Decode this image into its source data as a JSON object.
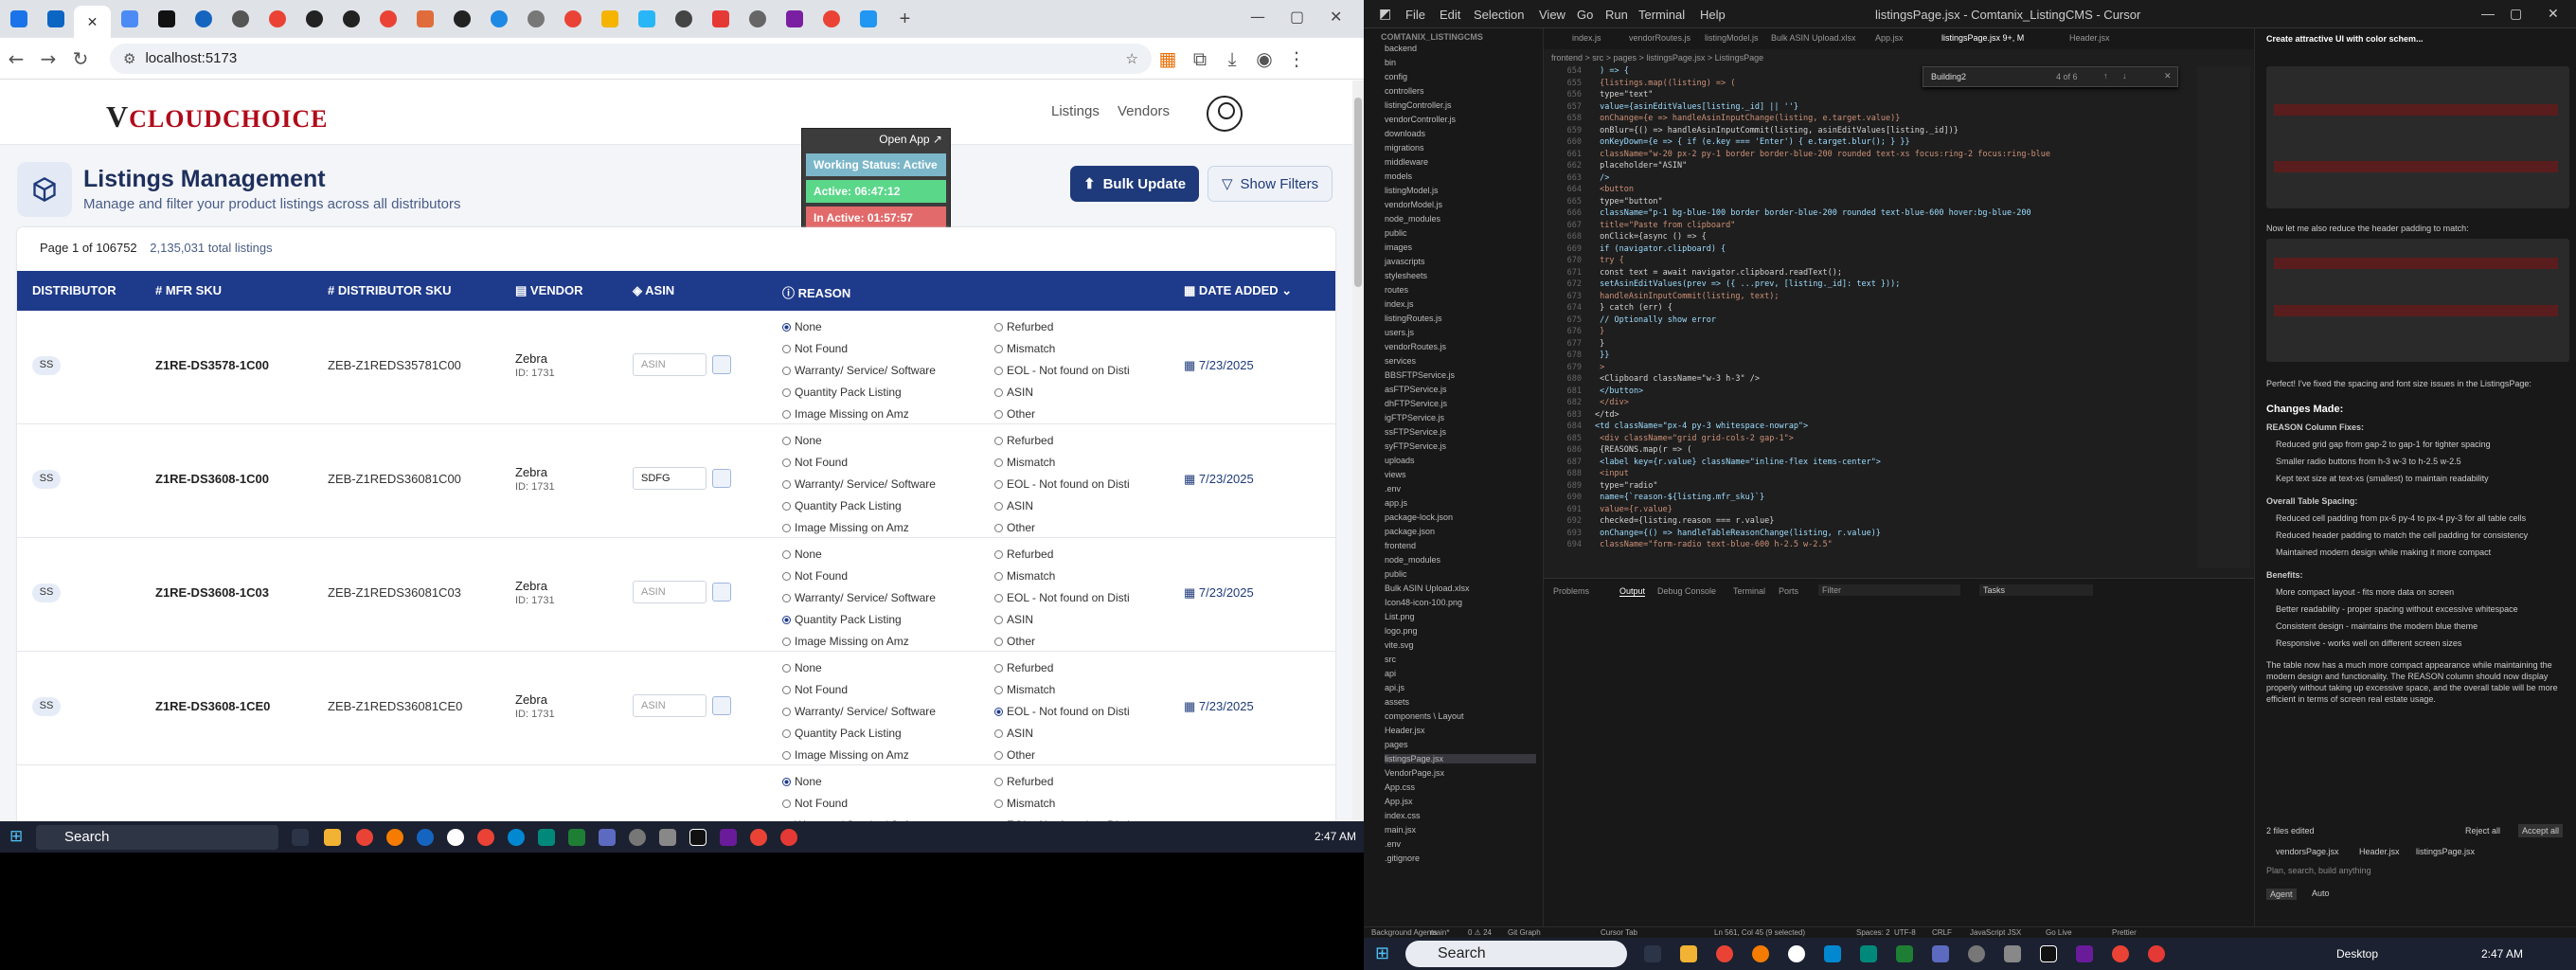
{
  "browser": {
    "url": "localhost:5173"
  },
  "app": {
    "logo_text": "CLOUDCHOICE",
    "logo_v": "V",
    "nav": [
      "Listings",
      "Vendors"
    ],
    "status_popup": {
      "open_label": "Open App ↗",
      "working": "Working Status: Active",
      "active": "Active: 06:47:12",
      "inactive": "In Active: 01:57:57"
    },
    "title": "Listings Management",
    "subtitle": "Manage and filter your product listings across all distributors",
    "bulk_label": "Bulk Update",
    "filters_label": "Show Filters",
    "page_info": "Page 1 of 106752",
    "total": "2,135,031 total listings",
    "columns": [
      "DISTRIBUTOR",
      "MFR SKU",
      "DISTRIBUTOR SKU",
      "VENDOR",
      "ASIN",
      "REASON",
      "DATE ADDED"
    ],
    "asin_placeholder": "ASIN",
    "reasons_left": [
      "None",
      "Not Found",
      "Warranty/ Service/ Software",
      "Quantity Pack Listing",
      "Image Missing on Amz"
    ],
    "reasons_right": [
      "Refurbed",
      "Mismatch",
      "EOL - Not found on Disti",
      "ASIN",
      "Other"
    ],
    "rows": [
      {
        "dist": "SS",
        "mfr": "Z1RE-DS3578-1C00",
        "dsku": "ZEB-Z1REDS35781C00",
        "vendor": "Zebra",
        "vid": "ID: 1731",
        "asin": "",
        "sel": "None",
        "date": "7/23/2025"
      },
      {
        "dist": "SS",
        "mfr": "Z1RE-DS3608-1C00",
        "dsku": "ZEB-Z1REDS36081C00",
        "vendor": "Zebra",
        "vid": "ID: 1731",
        "asin": "SDFG",
        "sel": "",
        "date": "7/23/2025"
      },
      {
        "dist": "SS",
        "mfr": "Z1RE-DS3608-1C03",
        "dsku": "ZEB-Z1REDS36081C03",
        "vendor": "Zebra",
        "vid": "ID: 1731",
        "asin": "",
        "sel": "Quantity Pack Listing",
        "date": "7/23/2025"
      },
      {
        "dist": "SS",
        "mfr": "Z1RE-DS3608-1CE0",
        "dsku": "ZEB-Z1REDS36081CE0",
        "vendor": "Zebra",
        "vid": "ID: 1731",
        "asin": "",
        "sel": "EOL - Not found on Disti",
        "date": "7/23/2025"
      }
    ],
    "partial_row": {
      "sel": "None"
    }
  },
  "taskbar": {
    "search": "Search",
    "time": "2:47 AM",
    "desktop": "Desktop"
  },
  "vscode": {
    "menus": [
      "File",
      "Edit",
      "Selection",
      "View",
      "Go",
      "Run",
      "Terminal",
      "Help"
    ],
    "window_title": "listingsPage.jsx - Comtanix_ListingCMS - Cursor",
    "explorer_header": "COMTANIX_LISTINGCMS",
    "tree": [
      "backend",
      "bin",
      "config",
      "controllers",
      "listingController.js",
      "vendorController.js",
      "downloads",
      "migrations",
      "middleware",
      "models",
      "listingModel.js",
      "vendorModel.js",
      "node_modules",
      "public",
      "images",
      "javascripts",
      "stylesheets",
      "routes",
      "index.js",
      "listingRoutes.js",
      "users.js",
      "vendorRoutes.js",
      "services",
      "BBSFTPService.js",
      "asFTPService.js",
      "dhFTPService.js",
      "igFTPService.js",
      "ssFTPService.js",
      "syFTPService.js",
      "uploads",
      "views",
      ".env",
      "app.js",
      "package-lock.json",
      "package.json",
      "frontend",
      "node_modules",
      "public",
      "Bulk ASIN Upload.xlsx",
      "Icon48-icon-100.png",
      "List.png",
      "logo.png",
      "vite.svg",
      "src",
      "api",
      "api.js",
      "assets",
      "components \\ Layout",
      "Header.jsx",
      "pages",
      "listingsPage.jsx",
      "VendorPage.jsx",
      "App.css",
      "App.jsx",
      "index.css",
      "main.jsx",
      ".env",
      ".gitignore"
    ],
    "tabs": [
      "index.js",
      "vendorRoutes.js",
      "listingModel.js",
      "Bulk ASIN Upload.xlsx",
      "App.jsx",
      "listingsPage.jsx 9+, M",
      "Header.jsx"
    ],
    "breadcrumb": "frontend > src > pages > listingsPage.jsx > ListingsPage",
    "find_text": "Building2",
    "find_count": "4 of 6",
    "code": [
      [
        "654",
        "  ) => {"
      ],
      [
        "655",
        "    {listings.map((listing) => ("
      ],
      [
        "656",
        "      type=\"text\""
      ],
      [
        "657",
        "      value={asinEditValues[listing._id] || ''}"
      ],
      [
        "658",
        "      onChange={e => handleAsinInputChange(listing, e.target.value)}"
      ],
      [
        "659",
        "      onBlur={() => handleAsinInputCommit(listing, asinEditValues[listing._id])}"
      ],
      [
        "660",
        "      onKeyDown={e => { if (e.key === 'Enter') { e.target.blur(); } }}"
      ],
      [
        "661",
        "      className=\"w-20 px-2 py-1 border border-blue-200 rounded text-xs focus:ring-2 focus:ring-blue"
      ],
      [
        "662",
        "      placeholder=\"ASIN\""
      ],
      [
        "663",
        "    />"
      ],
      [
        "664",
        "    <button"
      ],
      [
        "665",
        "      type=\"button\""
      ],
      [
        "666",
        "      className=\"p-1 bg-blue-100 border border-blue-200 rounded text-blue-600 hover:bg-blue-200"
      ],
      [
        "667",
        "      title=\"Paste from clipboard\""
      ],
      [
        "668",
        "      onClick={async () => {"
      ],
      [
        "669",
        "        if (navigator.clipboard) {"
      ],
      [
        "670",
        "          try {"
      ],
      [
        "671",
        "            const text = await navigator.clipboard.readText();"
      ],
      [
        "672",
        "            setAsinEditValues(prev => ({ ...prev, [listing._id]: text }));"
      ],
      [
        "673",
        "            handleAsinInputCommit(listing, text);"
      ],
      [
        "674",
        "          } catch (err) {"
      ],
      [
        "675",
        "            // Optionally show error"
      ],
      [
        "676",
        "          }"
      ],
      [
        "677",
        "        }"
      ],
      [
        "678",
        "      }}"
      ],
      [
        "679",
        "    >"
      ],
      [
        "680",
        "      <Clipboard className=\"w-3 h-3\" />"
      ],
      [
        "681",
        "    </button>"
      ],
      [
        "682",
        "  </div>"
      ],
      [
        "683",
        "</td>"
      ],
      [
        "684",
        "<td className=\"px-4 py-3 whitespace-nowrap\">"
      ],
      [
        "685",
        "  <div className=\"grid grid-cols-2 gap-1\">"
      ],
      [
        "686",
        "    {REASONS.map(r => ("
      ],
      [
        "687",
        "      <label key={r.value} className=\"inline-flex items-center\">"
      ],
      [
        "688",
        "        <input"
      ],
      [
        "689",
        "          type=\"radio\""
      ],
      [
        "690",
        "          name={`reason-${listing.mfr_sku}`}"
      ],
      [
        "691",
        "          value={r.value}"
      ],
      [
        "692",
        "          checked={listing.reason === r.value}"
      ],
      [
        "693",
        "          onChange={() => handleTableReasonChange(listing, r.value)}"
      ],
      [
        "694",
        "          className=\"form-radio text-blue-600 h-2.5 w-2.5\""
      ]
    ],
    "panel_tabs": [
      "Problems",
      "Output",
      "Debug Console",
      "Terminal",
      "Ports"
    ],
    "panel_filter": "Filter",
    "panel_dropdown": "Tasks",
    "chat": {
      "heading": "Create attractive UI with color schem...",
      "msg1": "Now let me also reduce the header padding to match:",
      "msg2": "Perfect! I've fixed the spacing and font size issues in the ListingsPage:",
      "changes": "Changes Made:",
      "reason_fixes": "REASON Column Fixes:",
      "b1": "Reduced grid gap from gap-2 to gap-1 for tighter spacing",
      "b2": "Smaller radio buttons from h-3 w-3 to h-2.5 w-2.5",
      "b3": "Kept text size at text-xs (smallest) to maintain readability",
      "table_spacing": "Overall Table Spacing:",
      "b4": "Reduced cell padding from px-6 py-4 to px-4 py-3 for all table cells",
      "b5": "Reduced header padding to match the cell padding for consistency",
      "b6": "Maintained modern design while making it more compact",
      "benefits": "Benefits:",
      "c1": "More compact layout - fits more data on screen",
      "c2": "Better readability - proper spacing without excessive whitespace",
      "c3": "Consistent design - maintains the modern blue theme",
      "c4": "Responsive - works well on different screen sizes",
      "summary": "The table now has a much more compact appearance while maintaining the modern design and functionality. The REASON column should now display properly without taking up excessive space, and the overall table will be more efficient in terms of screen real estate usage.",
      "files": "2 files edited",
      "reject": "Reject all",
      "accept": "Accept all",
      "ctx": [
        "vendorsPage.jsx",
        "Header.jsx",
        "listingsPage.jsx"
      ],
      "input_ph": "Plan, search, build anything",
      "agent": "Agent",
      "auto": "Auto"
    },
    "status": [
      "Background Agents",
      "main*",
      "0 ⚠ 24",
      "Git Graph",
      "Cursor Tab",
      "Ln 561, Col 45 (9 selected)",
      "Spaces: 2",
      "UTF-8",
      "CRLF",
      "JavaScript JSX",
      "Go Live",
      "Prettier"
    ]
  }
}
